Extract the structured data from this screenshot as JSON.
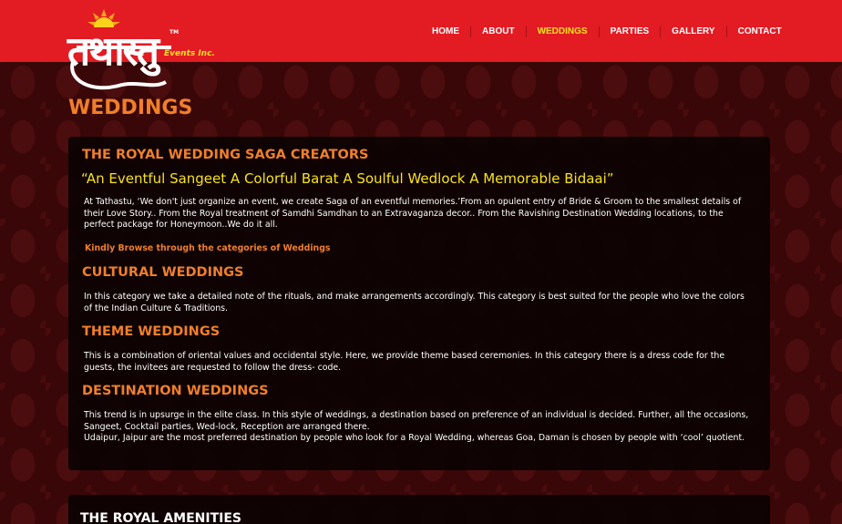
{
  "brand": {
    "logo_text": "तथास्तु",
    "trademark": "TM",
    "subtitle": "Events Inc."
  },
  "nav": {
    "items": [
      {
        "label": "HOME"
      },
      {
        "label": "ABOUT"
      },
      {
        "label": "WEDDINGS"
      },
      {
        "label": "PARTIES"
      },
      {
        "label": "GALLERY"
      },
      {
        "label": "CONTACT"
      }
    ],
    "active": "WEDDINGS"
  },
  "page": {
    "title": "WEDDINGS"
  },
  "main": {
    "heading": "THE ROYAL WEDDING SAGA CREATORS",
    "tagline": "“An Eventful Sangeet A Colorful Barat A Soulful Wedlock A Memorable Bidaai”",
    "intro": "At Tathastu, ‘We don't just organize an event, we create Saga of an eventful memories.’From an opulent entry of Bride & Groom to the smallest details of their Love Story.. From the Royal treatment of Samdhi Samdhan to an Extravaganza decor.. From the Ravishing Destination Wedding locations, to the perfect package for Honeymoon..We do it all.",
    "browse_note": "Kindly Browse through the categories of Weddings",
    "sections": [
      {
        "title": "CULTURAL WEDDINGS",
        "text": "In this category we take a detailed note of the rituals, and make arrangements accordingly. This category is best suited for the people who love the colors of the Indian Culture & Traditions."
      },
      {
        "title": "THEME WEDDINGS",
        "text": "This is a combination of oriental values and occidental style. Here, we provide theme based ceremonies. In this category there is a dress code for the guests, the invitees are requested to follow the dress- code."
      },
      {
        "title": "DESTINATION WEDDINGS",
        "text": "This trend is in upsurge in the elite class. In this style of weddings, a destination based on preference of an individual is decided. Further, all the occasions, Sangeet, Cocktail parties, Wed-lock, Reception are arranged there.",
        "text2": "Udaipur, Jaipur are the most preferred destination by people who look for a Royal Wedding, whereas Goa, Daman is chosen by people with ‘cool’ quotient."
      }
    ]
  },
  "amenities": {
    "heading": "THE ROYAL AMENITIES"
  },
  "colors": {
    "topbar": "#e31b23",
    "accent_orange": "#f07f2a",
    "accent_yellow": "#f9e21c",
    "background": "#3a0708"
  }
}
